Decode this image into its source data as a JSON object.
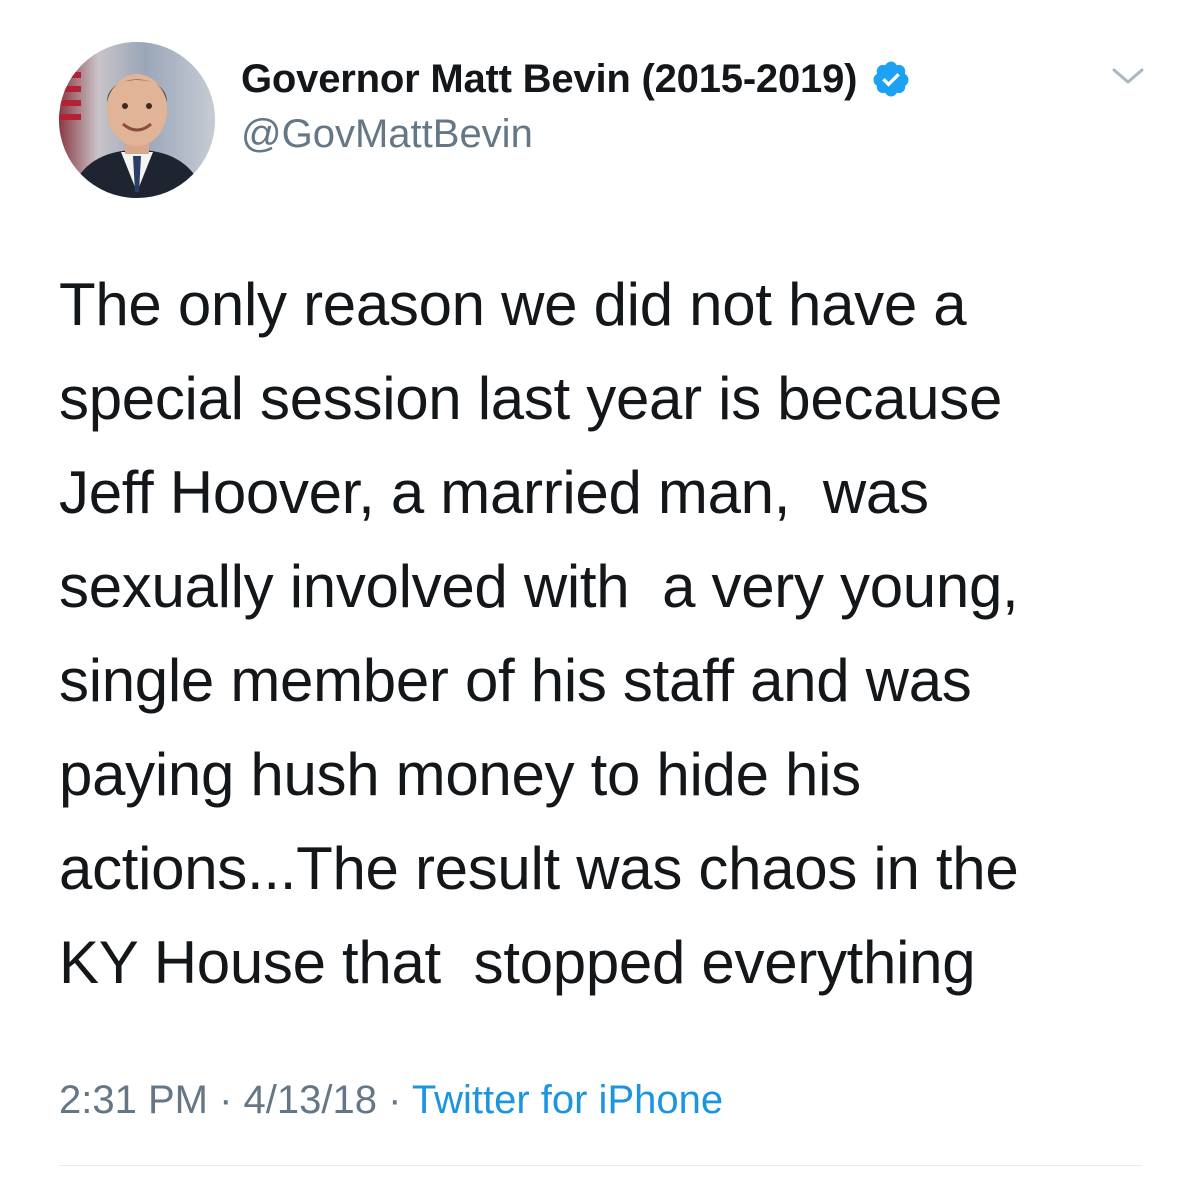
{
  "tweet": {
    "display_name": "Governor Matt Bevin (2015-2019)",
    "handle": "@GovMattBevin",
    "verified": true,
    "text_lines": [
      "The only reason we did not have a",
      "special session last year is because",
      "Jeff Hoover, a married man,  was",
      "sexually involved with  a very young,",
      "single member of his staff and was",
      "paying hush money to hide his",
      "actions...The result was chaos in the",
      "KY House that  stopped everything"
    ],
    "time": "2:31 PM",
    "date": "4/13/18",
    "separator": "·",
    "source": "Twitter for iPhone"
  },
  "icons": {
    "verified": "verified-badge-icon",
    "menu": "chevron-down-icon"
  },
  "colors": {
    "text": "#14171a",
    "secondary": "#657786",
    "link": "#1b95e0",
    "verified": "#1da1f2",
    "divider": "#e6ecf0"
  }
}
